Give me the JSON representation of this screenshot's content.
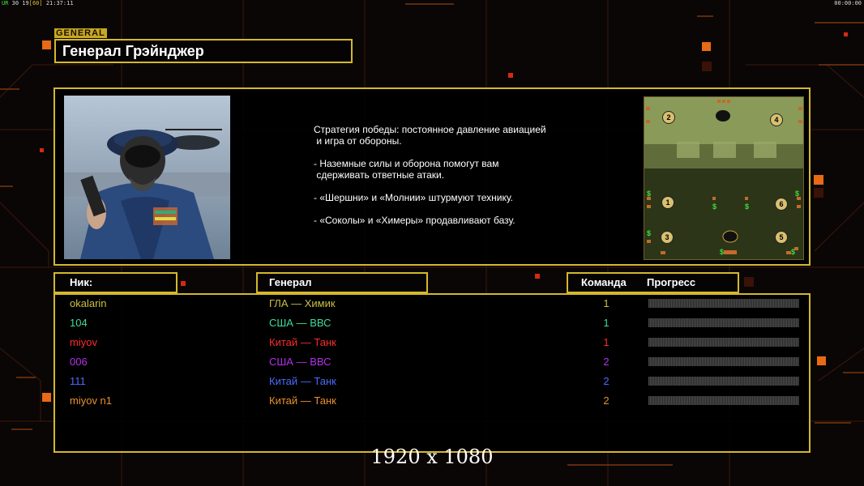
{
  "hud": {
    "status_prefix": "UR",
    "status_middle": " 30 19",
    "status_bracket": "[60]",
    "clock": "21:37:11",
    "timer": "00:00:00"
  },
  "general": {
    "tag": "GENERAL",
    "name": "Генерал Грэйнджер",
    "description": [
      "Стратегия победы: постоянное давление авиацией",
      " и игра от обороны.",
      "",
      "- Наземные силы и оборона помогут вам",
      " сдерживать ответные атаки.",
      "",
      "- «Шершни» и «Молнии» штурмуют технику.",
      "",
      "- «Соколы» и «Химеры» продавливают базу."
    ]
  },
  "minimap": {
    "start_positions": [
      "2",
      "4",
      "1",
      "6",
      "3",
      "5"
    ],
    "money_symbol": "$"
  },
  "table": {
    "headers": {
      "nick": "Ник:",
      "general": "Генерал",
      "team": "Команда",
      "progress": "Прогресс"
    },
    "players": [
      {
        "nick": "okalarin",
        "general": "ГЛА — Химик",
        "team": "1",
        "color": "#c8c040",
        "progress": 0
      },
      {
        "nick": "104",
        "general": "США — ВВС",
        "team": "1",
        "color": "#3ddc9a",
        "progress": 0
      },
      {
        "nick": "miyov",
        "general": "Китай — Танк",
        "team": "1",
        "color": "#ff2b2b",
        "progress": 0
      },
      {
        "nick": "006",
        "general": "США — ВВС",
        "team": "2",
        "color": "#b032e8",
        "progress": 0
      },
      {
        "nick": "111",
        "general": "Китай — Танк",
        "team": "2",
        "color": "#4a6cff",
        "progress": 0
      },
      {
        "nick": "miyov n1",
        "general": "Китай — Танк",
        "team": "2",
        "color": "#e89030",
        "progress": 0
      }
    ]
  },
  "caption": "1920 x 1080",
  "colors": {
    "frame": "#d4b82c",
    "accent_orange": "#e86a14"
  }
}
